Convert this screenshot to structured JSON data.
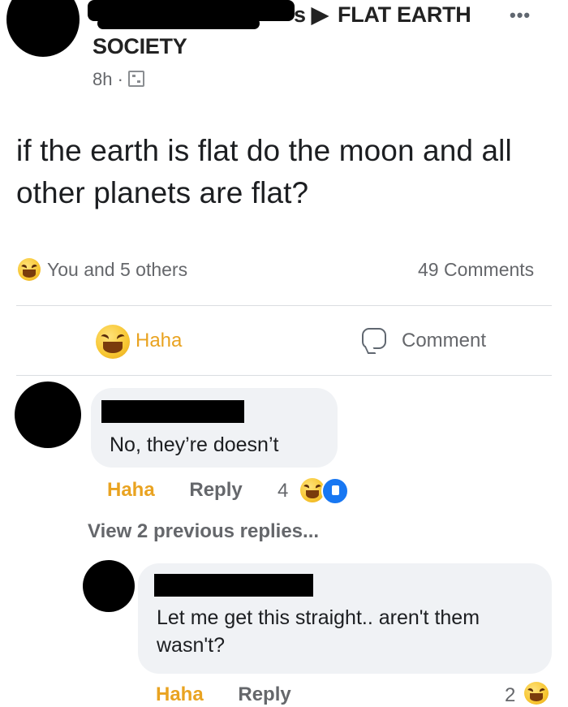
{
  "post": {
    "group_name_part1": "FLAT EARTH",
    "group_name_part2": "SOCIETY",
    "breadcrumb_suffix": "s ▶",
    "time": "8h",
    "separator": "·",
    "more": "•••",
    "text": "if the earth is flat do the moon and all other planets are flat?",
    "reactions_label": "You and 5 others",
    "comments_count": "49 Comments"
  },
  "actions": {
    "haha": "Haha",
    "comment": "Comment"
  },
  "comments": [
    {
      "text": "No, they’re doesn’t",
      "haha": "Haha",
      "reply": "Reply",
      "reaction_count": "4"
    },
    {
      "view_previous": "View 2 previous replies..."
    },
    {
      "text": "Let me get this straight.. aren't them wasn't?",
      "haha": "Haha",
      "reply": "Reply",
      "reaction_count": "2"
    }
  ],
  "colors": {
    "haha": "#e9a321",
    "secondary_text": "#65676b",
    "bubble": "#f0f2f5",
    "like": "#1877f2"
  },
  "icons": [
    "haha-emoji-icon",
    "like-icon",
    "comment-icon",
    "privacy-group-icon",
    "more-icon"
  ]
}
